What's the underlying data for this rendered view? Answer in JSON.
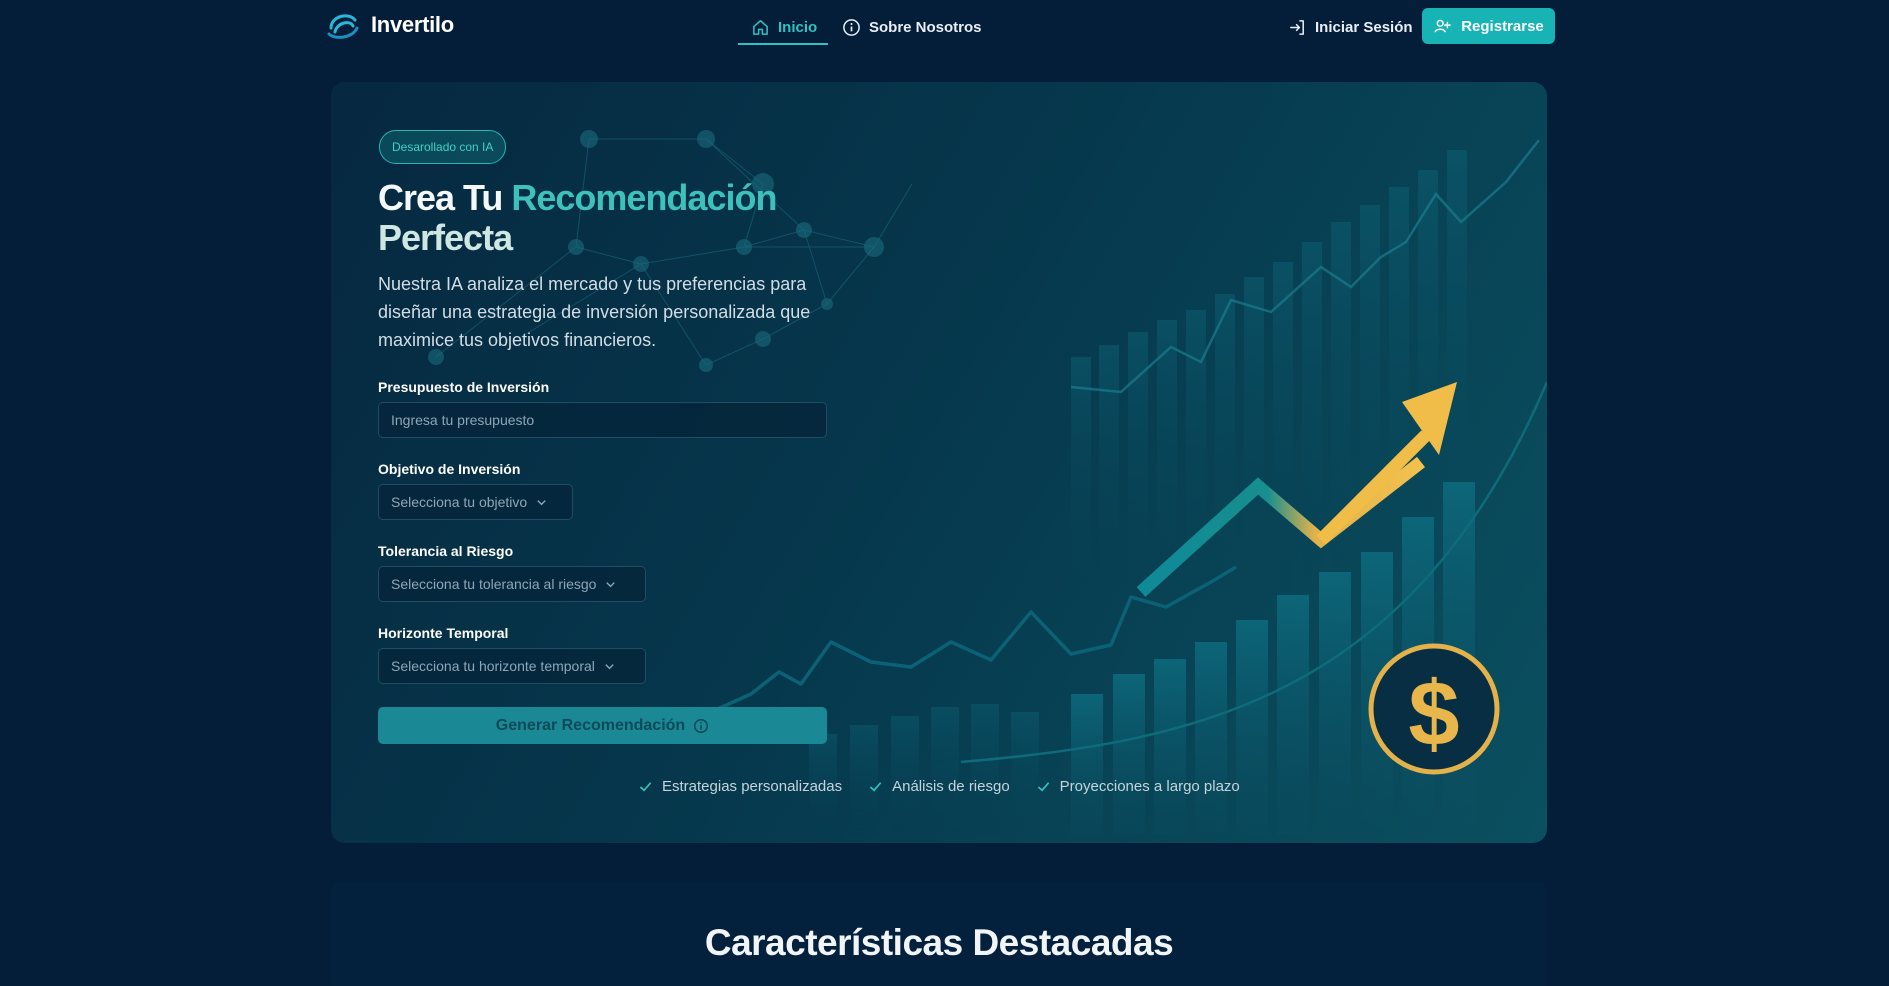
{
  "nav": {
    "brand": "Invertilo",
    "links": [
      {
        "label": "Inicio",
        "icon": "home-icon",
        "active": true
      },
      {
        "label": "Sobre Nosotros",
        "icon": "info-icon",
        "active": false
      }
    ],
    "login_label": "Iniciar Sesión",
    "register_label": "Registrarse"
  },
  "hero": {
    "badge": "Desarollado con IA",
    "title_part1": "Crea Tu ",
    "title_accent": "Recomendación",
    "title_part2": "Perfecta",
    "description": "Nuestra IA analiza el mercado y tus preferencias para diseñar una estrategia de inversión personalizada que maximice tus objetivos financieros.",
    "form": {
      "budget_label": "Presupuesto de Inversión",
      "budget_placeholder": "Ingresa tu presupuesto",
      "goal_label": "Objetivo de Inversión",
      "goal_value": "Selecciona tu objetivo",
      "risk_label": "Tolerancia al Riesgo",
      "risk_value": "Selecciona tu tolerancia al riesgo",
      "horizon_label": "Horizonte Temporal",
      "horizon_value": "Selecciona tu horizonte temporal",
      "submit_label": "Generar Recomendación"
    },
    "features": [
      "Estrategias personalizadas",
      "Análisis de riesgo",
      "Proyecciones a largo plazo"
    ]
  },
  "section2": {
    "title": "Características Destacadas"
  },
  "colors": {
    "background": "#041e3a",
    "accent": "#17b3b5",
    "accent_text": "#3ec1bb",
    "gold": "#f0bd48"
  }
}
